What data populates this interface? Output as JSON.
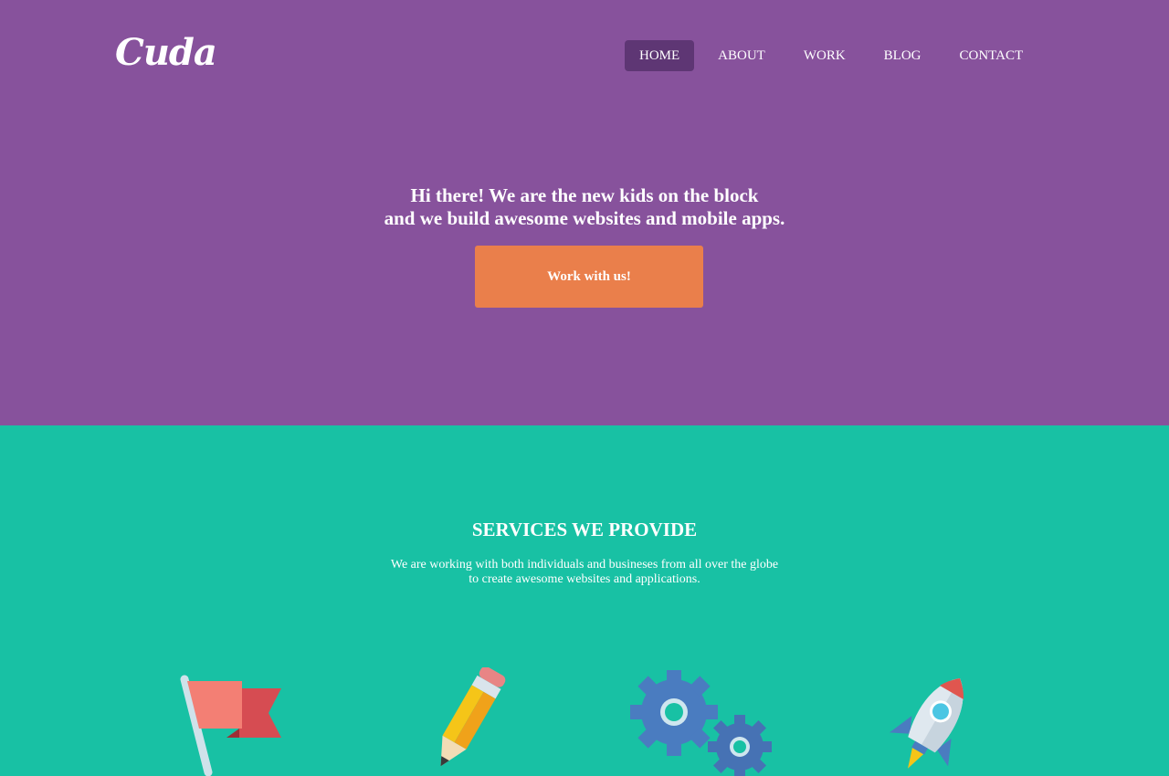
{
  "brand": {
    "logo_text": "Cuda"
  },
  "nav": {
    "items": [
      {
        "label": "HOME",
        "active": true
      },
      {
        "label": "ABOUT",
        "active": false
      },
      {
        "label": "WORK",
        "active": false
      },
      {
        "label": "BLOG",
        "active": false
      },
      {
        "label": "CONTACT",
        "active": false
      }
    ]
  },
  "hero": {
    "line1": "Hi there! We are the new kids on the block",
    "line2": "and we build awesome websites and mobile apps.",
    "cta_label": "Work with us!"
  },
  "services": {
    "title": "SERVICES WE PROVIDE",
    "subtitle_line1": "We are working with both individuals and busineses from all over the globe",
    "subtitle_line2": "to create awesome websites and applications.",
    "icons": [
      "flag-icon",
      "pencil-icon",
      "gears-icon",
      "rocket-icon"
    ]
  },
  "colors": {
    "hero_bg": "#87529c",
    "services_bg": "#18c1a4",
    "cta_bg": "#ea7f4b",
    "nav_active_bg": "#5e3674"
  }
}
